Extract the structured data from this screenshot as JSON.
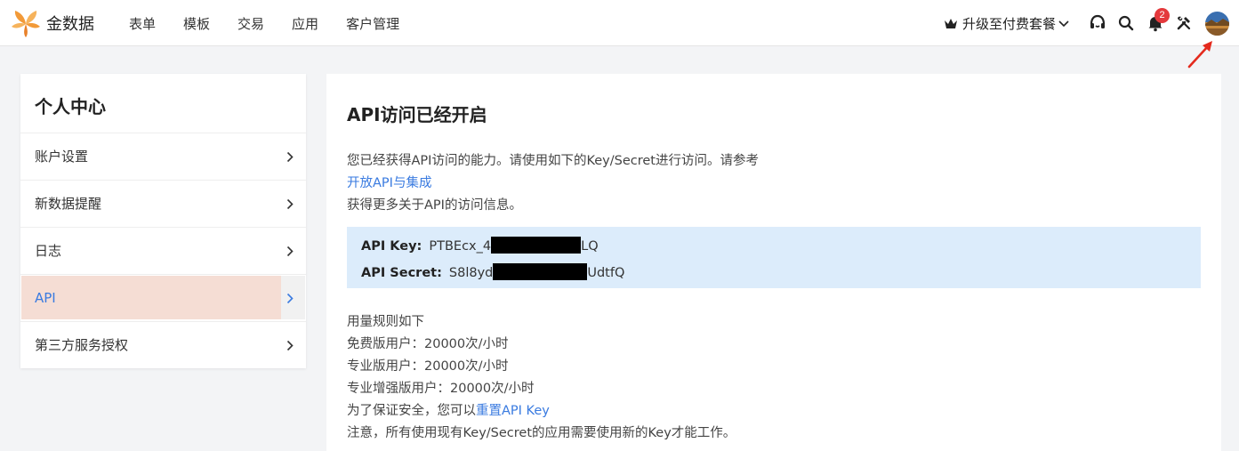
{
  "app": {
    "name": "金数据"
  },
  "nav": {
    "items": [
      "表单",
      "模板",
      "交易",
      "应用",
      "客户管理"
    ]
  },
  "header": {
    "upgrade_label": "升级至付费套餐",
    "notification_count": "2"
  },
  "sidebar": {
    "title": "个人中心",
    "items": [
      {
        "label": "账户设置"
      },
      {
        "label": "新数据提醒"
      },
      {
        "label": "日志"
      },
      {
        "label": "API",
        "active": true
      },
      {
        "label": "第三方服务授权"
      }
    ]
  },
  "main": {
    "title": "API访问已经开启",
    "intro_line1": "您已经获得API访问的能力。请使用如下的Key/Secret进行访问。请参考",
    "intro_link": "开放API与集成",
    "intro_line3": "获得更多关于API的访问信息。",
    "api_key_label": "API Key:",
    "api_key_prefix": "PTBEcx_4",
    "api_key_suffix": "LQ",
    "api_secret_label": "API Secret:",
    "api_secret_prefix": "S8l8yd",
    "api_secret_suffix": "UdtfQ",
    "usage_title": "用量规则如下",
    "usage_free": "免费版用户：20000次/小时",
    "usage_pro": "专业版用户：20000次/小时",
    "usage_pro_plus": "专业增强版用户：20000次/小时",
    "security_prefix": "为了保证安全，您可以",
    "reset_link": "重置API Key",
    "notice": "注意，所有使用现有Key/Secret的应用需要使用新的Key才能工作。"
  },
  "colors": {
    "accent": "#3a7be0",
    "active_bg": "#f5ddd4",
    "keybox_bg": "#dcecfb",
    "badge": "#e4393c",
    "logo": "#f29a38"
  }
}
